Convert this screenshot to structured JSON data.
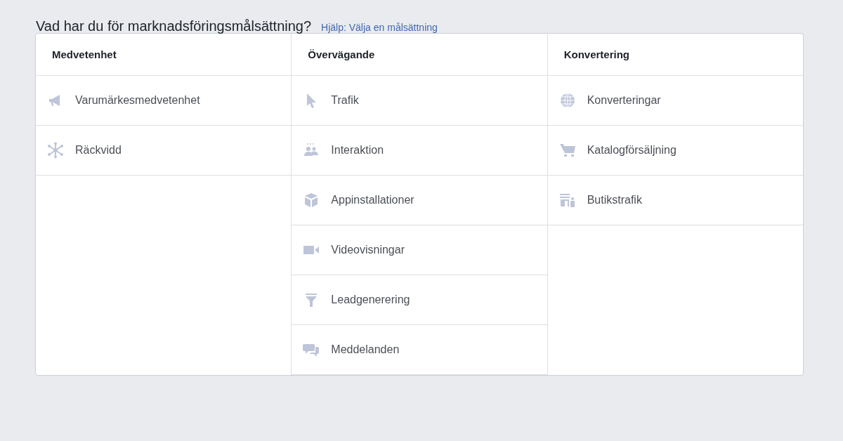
{
  "heading": {
    "title": "Vad har du för marknadsföringsmålsättning?",
    "help_link": "Hjälp: Välja en målsättning"
  },
  "columns": [
    {
      "title": "Medvetenhet",
      "items": [
        {
          "label": "Varumärkesmedvetenhet"
        },
        {
          "label": "Räckvidd"
        }
      ]
    },
    {
      "title": "Övervägande",
      "items": [
        {
          "label": "Trafik"
        },
        {
          "label": "Interaktion"
        },
        {
          "label": "Appinstallationer"
        },
        {
          "label": "Videovisningar"
        },
        {
          "label": "Leadgenerering"
        },
        {
          "label": "Meddelanden"
        }
      ]
    },
    {
      "title": "Konvertering",
      "items": [
        {
          "label": "Konverteringar"
        },
        {
          "label": "Katalogförsäljning"
        },
        {
          "label": "Butikstrafik"
        }
      ]
    }
  ]
}
